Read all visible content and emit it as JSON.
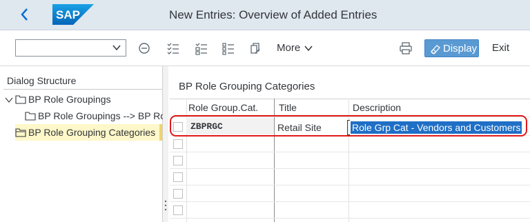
{
  "header": {
    "title": "New Entries: Overview of Added Entries",
    "logo_text": "SAP",
    "brand_color": "#0a6ed1"
  },
  "toolbar": {
    "select_value": "",
    "more_label": "More",
    "display_label": "Display",
    "exit_label": "Exit",
    "icons": [
      "minus-circle-icon",
      "select-all-icon",
      "deselect-all-icon",
      "details-icon",
      "copy-icon",
      "print-icon"
    ]
  },
  "dialog_structure": {
    "title": "Dialog Structure",
    "items": [
      {
        "label": "BP Role Groupings",
        "level": 0,
        "expanded": true
      },
      {
        "label": "BP Role Groupings --> BP Ro",
        "level": 1
      },
      {
        "label": "BP Role Grouping Categories",
        "level": 0,
        "selected": true
      }
    ]
  },
  "main": {
    "section_title": "BP Role Grouping Categories",
    "columns": [
      "Role Group.Cat.",
      "Title",
      "Description"
    ],
    "rows": [
      {
        "code": "ZBPRGC",
        "title": "Retail Site",
        "description": "Role Grp Cat - Vendors and Customers"
      }
    ],
    "empty_rows": 5
  }
}
